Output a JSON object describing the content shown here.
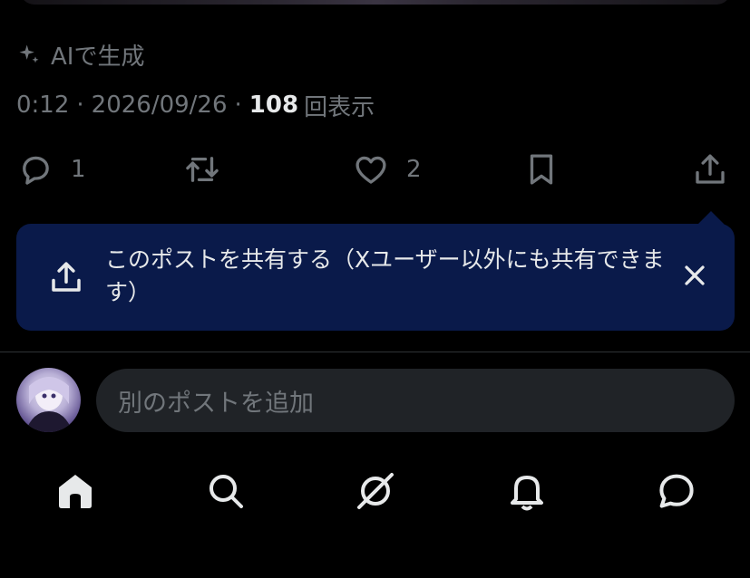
{
  "post": {
    "ai_label": "AIで生成",
    "time": "0:12",
    "separator": "·",
    "date": "2026/09/26",
    "views_count": "108",
    "views_label": "回表示"
  },
  "actions": {
    "reply_count": "1",
    "like_count": "2"
  },
  "toast": {
    "text": "このポストを共有する（Xユーザー以外にも共有できます）"
  },
  "reply": {
    "placeholder": "別のポストを追加"
  },
  "tabs": [
    "home",
    "search",
    "grok",
    "notifications",
    "messages"
  ],
  "colors": {
    "background": "#000000",
    "muted": "#71767b",
    "primary_text": "#e7e9ea",
    "toast_bg": "#0a1a4a",
    "input_bg": "#202327"
  }
}
